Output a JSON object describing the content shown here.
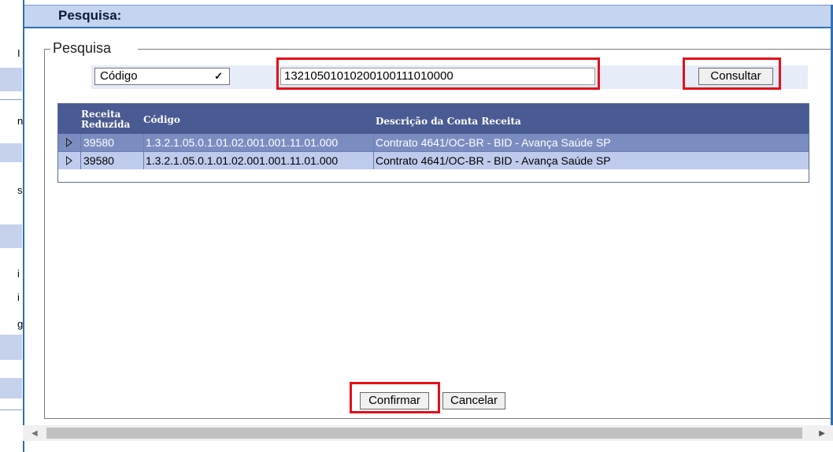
{
  "background": {
    "fragments": [
      "n",
      "s",
      "i",
      "i",
      "g"
    ]
  },
  "dialog": {
    "title": "Pesquisa:"
  },
  "fieldset": {
    "legend": "Pesquisa"
  },
  "search": {
    "field_selected": "Código",
    "query_value": "13210501010200100111010000",
    "consultar_label": "Consultar"
  },
  "table": {
    "headers": [
      "Receita\nReduzida",
      "Código",
      "Descrição da Conta Receita"
    ],
    "rows": [
      {
        "receita_reduzida": "39580",
        "codigo": "1.3.2.1.05.0.1.01.02.001.001.11.01.000",
        "descricao": "Contrato 4641/OC-BR - BID - Avança Saúde SP"
      },
      {
        "receita_reduzida": "39580",
        "codigo": "1.3.2.1.05.0.1.01.02.001.001.11.01.000",
        "descricao": "Contrato 4641/OC-BR - BID - Avança Saúde SP"
      }
    ]
  },
  "footer": {
    "confirm_label": "Confirmar",
    "cancel_label": "Cancelar"
  },
  "colors": {
    "header_bg": "#4a5a92",
    "selected_row": "#7b8dc0",
    "row_alt": "#bfcbec",
    "highlight": "#e3101a",
    "title_bar": "#c5d4ef"
  }
}
